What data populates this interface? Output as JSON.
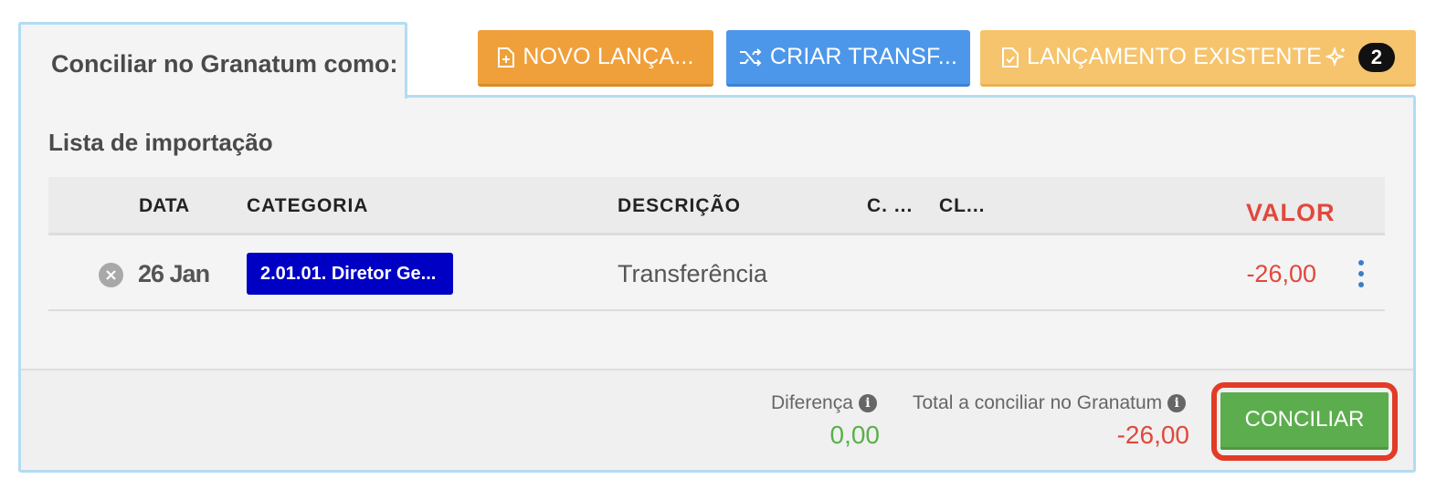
{
  "header": {
    "tab_title": "Conciliar no Granatum como:",
    "buttons": {
      "novo": {
        "label": "NOVO LANÇA...",
        "icon": "file-plus-icon",
        "color": "#f0a03a"
      },
      "transferencia": {
        "label": "CRIAR TRANSF...",
        "icon": "shuffle-icon",
        "color": "#4d97ea"
      },
      "existente": {
        "label": "LANÇAMENTO EXISTENTE",
        "icon": "file-check-icon",
        "extra_icon": "sparkle-icon",
        "badge": "2",
        "color": "#f6c46c"
      }
    }
  },
  "section": {
    "title": "Lista de importação"
  },
  "table": {
    "columns": [
      "DATA",
      "CATEGORIA",
      "DESCRIÇÃO",
      "C. ...",
      "CL...",
      "VALOR"
    ],
    "rows": [
      {
        "data": "26 Jan",
        "categoria": "2.01.01. Diretor Ge...",
        "descricao": "Transferência",
        "c": "",
        "cl": "",
        "valor": "-26,00"
      }
    ]
  },
  "footer": {
    "diferenca_label": "Diferença",
    "diferenca_value": "0,00",
    "total_label": "Total a conciliar no Granatum",
    "total_value": "-26,00",
    "conciliar_label": "CONCILIAR"
  },
  "colors": {
    "accent_border": "#b3dcf2",
    "negative": "#e0483c",
    "positive": "#5ab04a",
    "conciliar": "#5cad4e",
    "highlight_outline": "#e23b26",
    "category_chip": "#0000c4"
  }
}
